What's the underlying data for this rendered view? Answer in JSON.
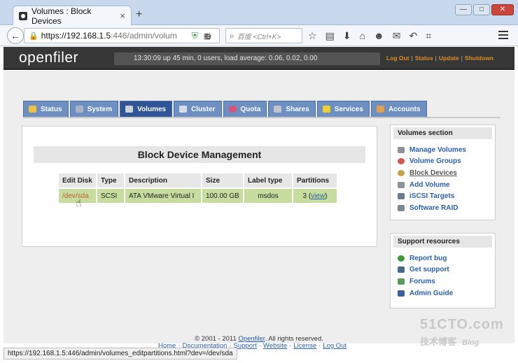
{
  "browser": {
    "tab_title": "Volumes : Block Devices",
    "tab_close": "×",
    "new_tab": "+",
    "url_main": "https://192.168.1.5",
    "url_rest": ":446/admin/volum",
    "search_placeholder": "百度 <Ctrl+K>",
    "window_buttons": [
      "—",
      "□",
      "✕"
    ],
    "status_link": "https://192.168.1.5:446/admin/volumes_editpartitions.html?dev=/dev/sda"
  },
  "header": {
    "logo": "openfiler",
    "status_text": "13:30:09 up 45 min, 0 users, load average: 0.06, 0.02, 0.00",
    "links": [
      "Log Out",
      "Status",
      "Update",
      "Shutdown"
    ]
  },
  "tabs": [
    {
      "label": "Status",
      "icon": "status-icon",
      "color": "#f0c040"
    },
    {
      "label": "System",
      "icon": "system-icon",
      "color": "#aab4c2"
    },
    {
      "label": "Volumes",
      "icon": "volumes-icon",
      "color": "#c8d0da",
      "active": true
    },
    {
      "label": "Cluster",
      "icon": "cluster-icon",
      "color": "#d8dce4"
    },
    {
      "label": "Quota",
      "icon": "quota-icon",
      "color": "#e05070"
    },
    {
      "label": "Shares",
      "icon": "shares-icon",
      "color": "#c0c4cc"
    },
    {
      "label": "Services",
      "icon": "services-icon",
      "color": "#f0d030"
    },
    {
      "label": "Accounts",
      "icon": "accounts-icon",
      "color": "#e0a050"
    }
  ],
  "main": {
    "heading": "Block Device Management",
    "table": {
      "headers": [
        "Edit Disk",
        "Type",
        "Description",
        "Size",
        "Label type",
        "Partitions"
      ],
      "rows": [
        {
          "edit_disk": "/dev/sda",
          "type": "SCSI",
          "description": "ATA VMware Virtual I",
          "size": "100.00 GB",
          "label_type": "msdos",
          "partitions_count": "3 (",
          "partitions_view": "view",
          "partitions_close": ")"
        }
      ]
    }
  },
  "volumes_section": {
    "title": "Volumes section",
    "items": [
      {
        "label": "Manage Volumes",
        "icon": "manage-volumes-icon",
        "color": "#8d939c"
      },
      {
        "label": "Volume Groups",
        "icon": "volume-groups-icon",
        "color": "#d9534f"
      },
      {
        "label": "Block Devices",
        "icon": "block-devices-icon",
        "color": "#c9a04a",
        "current": true
      },
      {
        "label": "Add Volume",
        "icon": "add-volume-icon",
        "color": "#8d939c"
      },
      {
        "label": "iSCSI Targets",
        "icon": "iscsi-targets-icon",
        "color": "#6b7a8c"
      },
      {
        "label": "Software RAID",
        "icon": "software-raid-icon",
        "color": "#7e8794"
      }
    ]
  },
  "support_section": {
    "title": "Support resources",
    "items": [
      {
        "label": "Report bug",
        "icon": "bug-icon",
        "color": "#3a9a3a"
      },
      {
        "label": "Get support",
        "icon": "support-icon",
        "color": "#4a6a8a"
      },
      {
        "label": "Forums",
        "icon": "forums-icon",
        "color": "#5a9a5a"
      },
      {
        "label": "Admin Guide",
        "icon": "admin-guide-icon",
        "color": "#3f5f9f"
      }
    ]
  },
  "footer": {
    "copyright_prefix": "© 2001 - 2011 ",
    "copyright_link": "Openfiler",
    "copyright_suffix": ". All rights reserved.",
    "links": [
      "Home",
      "Documentation",
      "Support",
      "Website",
      "License",
      "Log Out"
    ]
  },
  "watermark": {
    "line1": "51CTO.com",
    "line2": "技术博客",
    "line2b": "Blog"
  }
}
